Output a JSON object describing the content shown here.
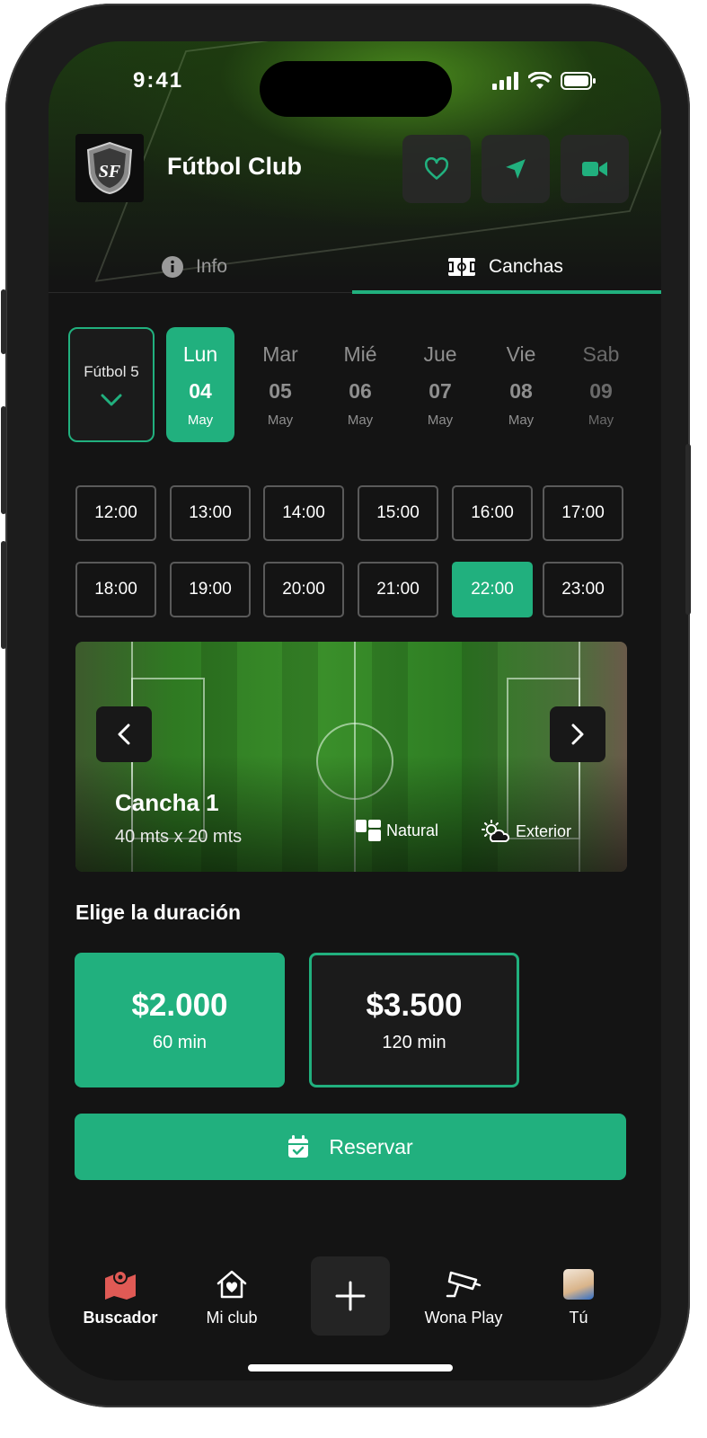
{
  "status": {
    "time": "9:41"
  },
  "header": {
    "title": "Fútbol Club",
    "logo_text": "SF"
  },
  "tabs": [
    {
      "label": "Info",
      "active": false
    },
    {
      "label": "Canchas",
      "active": true
    }
  ],
  "sport_select": {
    "value": "Fútbol 5"
  },
  "days": [
    {
      "name": "Lun",
      "num": "04",
      "month": "May",
      "selected": true
    },
    {
      "name": "Mar",
      "num": "05",
      "month": "May",
      "selected": false
    },
    {
      "name": "Mié",
      "num": "06",
      "month": "May",
      "selected": false
    },
    {
      "name": "Jue",
      "num": "07",
      "month": "May",
      "selected": false
    },
    {
      "name": "Vie",
      "num": "08",
      "month": "May",
      "selected": false
    },
    {
      "name": "Sab",
      "num": "09",
      "month": "May",
      "selected": false
    }
  ],
  "slots": [
    "12:00",
    "13:00",
    "14:00",
    "15:00",
    "16:00",
    "17:00",
    "18:00",
    "19:00",
    "20:00",
    "21:00",
    "22:00",
    "23:00"
  ],
  "selected_slot": "22:00",
  "court": {
    "name": "Cancha 1",
    "size": "40 mts x 20 mts",
    "surface": "Natural",
    "location": "Exterior"
  },
  "duration": {
    "title": "Elige la duración",
    "options": [
      {
        "price": "$2.000",
        "minutes": "60 min",
        "selected": true
      },
      {
        "price": "$3.500",
        "minutes": "120 min",
        "selected": false
      }
    ]
  },
  "reserve_label": "Reservar",
  "nav": [
    {
      "label": "Buscador",
      "icon": "map-icon",
      "active": true
    },
    {
      "label": "Mi club",
      "icon": "home-heart-icon",
      "active": false
    },
    {
      "label": "Wona Play",
      "icon": "camera-icon",
      "active": false
    },
    {
      "label": "Tú",
      "icon": "avatar",
      "active": false
    }
  ],
  "colors": {
    "accent": "#21b07e",
    "background": "#141414",
    "map_icon": "#e05a55"
  }
}
